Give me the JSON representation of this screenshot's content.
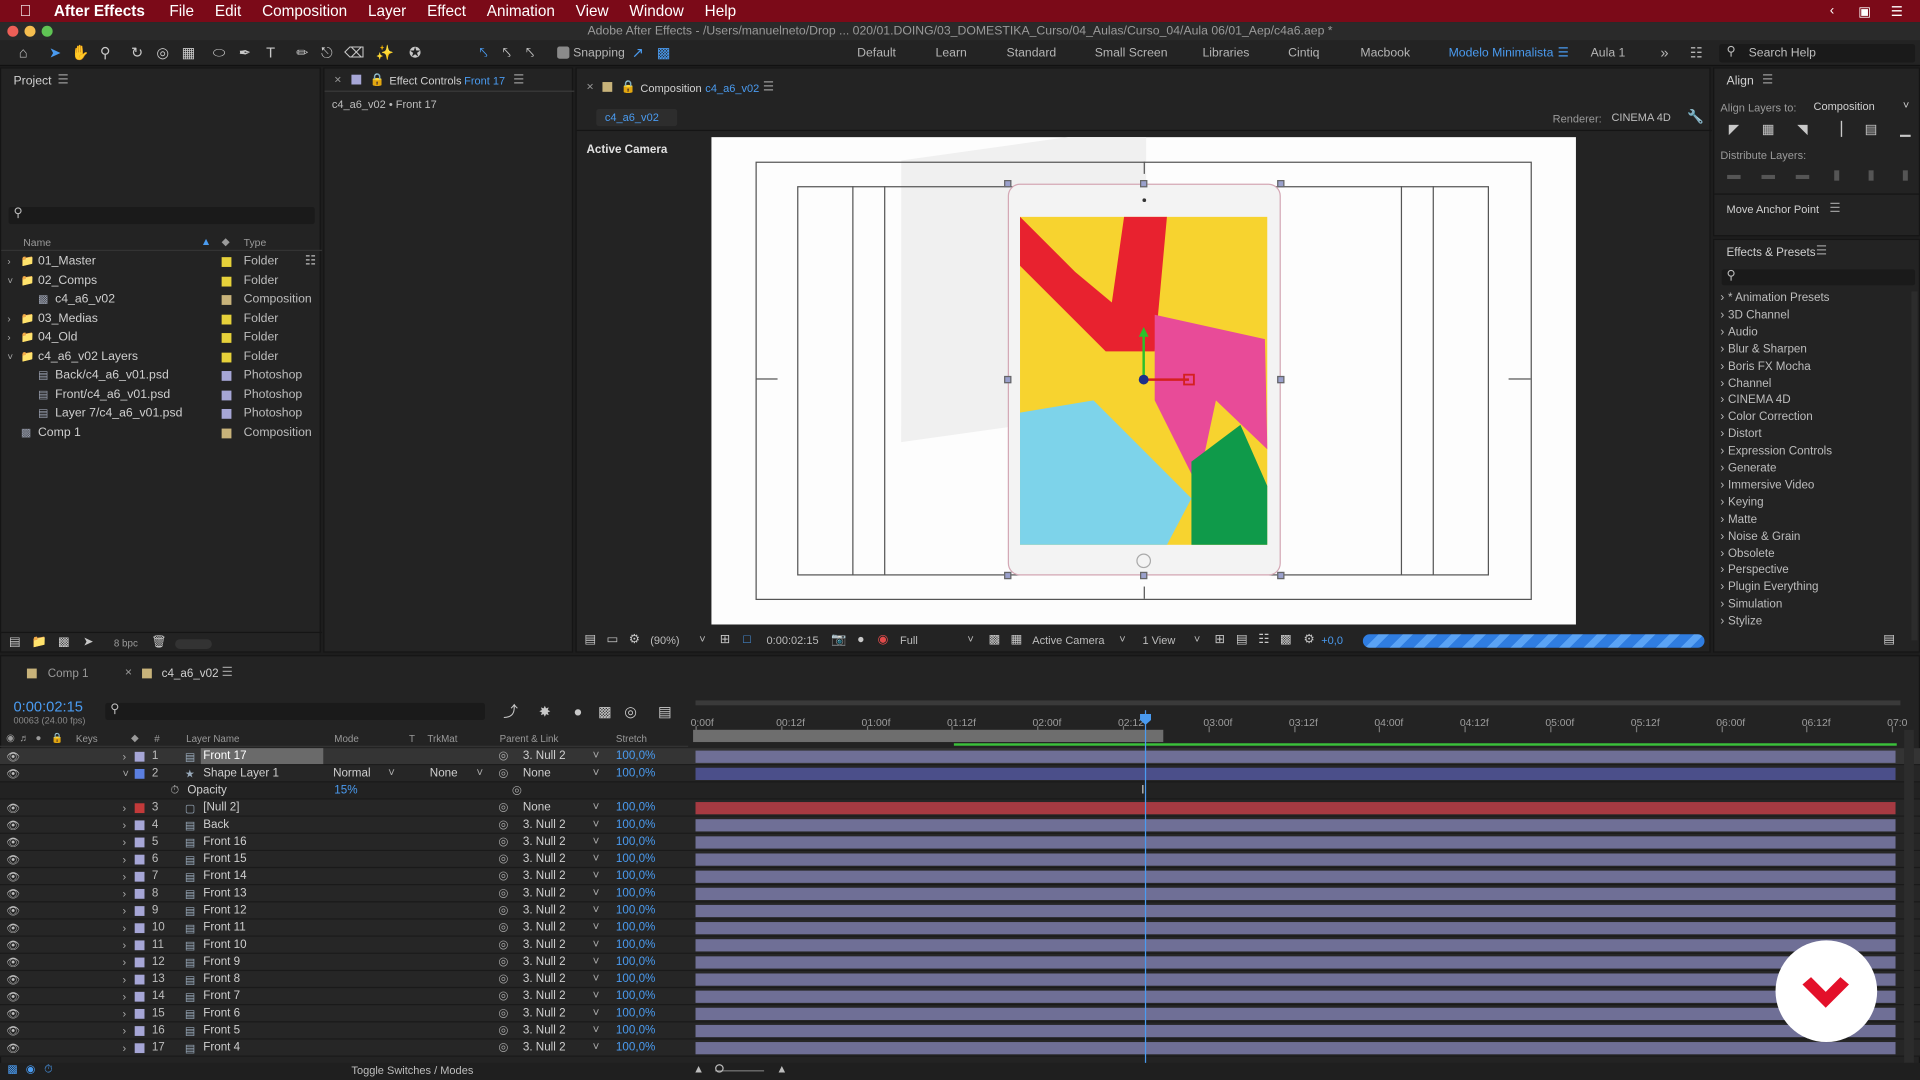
{
  "menu": {
    "app": "After Effects",
    "items": [
      "File",
      "Edit",
      "Composition",
      "Layer",
      "Effect",
      "Animation",
      "View",
      "Window",
      "Help"
    ]
  },
  "window_title": "Adobe After Effects - /Users/manuelneto/Drop ... 020/01.DOING/03_DOMESTIKA_Curso/04_Aulas/Curso_04/Aula 06/01_Aep/c4a6.aep *",
  "toolbar": {
    "snapping": "Snapping",
    "workspaces": [
      "Default",
      "Learn",
      "Standard",
      "Small Screen",
      "Libraries",
      "Cintiq",
      "Macbook",
      "Modelo Minimalista",
      "Aula 1"
    ],
    "active_workspace": "Modelo Minimalista",
    "search_help": "Search Help"
  },
  "project": {
    "title": "Project",
    "search_placeholder": "",
    "col_name": "Name",
    "col_type": "Type",
    "bpc": "8 bpc",
    "items": [
      {
        "name": "01_Master",
        "type": "Folder",
        "color": "#e6d13a"
      },
      {
        "name": "02_Comps",
        "type": "Folder",
        "color": "#e6d13a"
      },
      {
        "name": "c4_a6_v02",
        "type": "Composition",
        "color": "#c8b37a"
      },
      {
        "name": "03_Medias",
        "type": "Folder",
        "color": "#e6d13a"
      },
      {
        "name": "04_Old",
        "type": "Folder",
        "color": "#e6d13a"
      },
      {
        "name": "c4_a6_v02 Layers",
        "type": "Folder",
        "color": "#e6d13a"
      },
      {
        "name": "Back/c4_a6_v01.psd",
        "type": "Photoshop",
        "color": "#a6a6d6"
      },
      {
        "name": "Front/c4_a6_v01.psd",
        "type": "Photoshop",
        "color": "#a6a6d6"
      },
      {
        "name": "Layer 7/c4_a6_v01.psd",
        "type": "Photoshop",
        "color": "#a6a6d6"
      },
      {
        "name": "Comp 1",
        "type": "Composition",
        "color": "#c8b37a"
      }
    ]
  },
  "effect_controls": {
    "title": "Effect Controls",
    "layer": "Front 17",
    "subtitle": "c4_a6_v02 • Front 17"
  },
  "composition": {
    "title": "Composition",
    "name": "c4_a6_v02",
    "tab": "c4_a6_v02",
    "renderer_label": "Renderer:",
    "renderer": "CINEMA 4D",
    "view_label": "Active Camera",
    "footer": {
      "zoom": "(90%)",
      "timecode": "0:00:02:15",
      "resolution": "Full",
      "camera": "Active Camera",
      "views": "1 View",
      "exposure": "+0,0"
    }
  },
  "align": {
    "title": "Align",
    "align_to_label": "Align Layers to:",
    "align_to": "Composition",
    "distribute_label": "Distribute Layers:"
  },
  "move_anchor": {
    "title": "Move Anchor Point"
  },
  "effects": {
    "title": "Effects & Presets",
    "search_placeholder": "",
    "items": [
      "* Animation Presets",
      "3D Channel",
      "Audio",
      "Blur & Sharpen",
      "Boris FX Mocha",
      "Channel",
      "CINEMA 4D",
      "Color Correction",
      "Distort",
      "Expression Controls",
      "Generate",
      "Immersive Video",
      "Keying",
      "Matte",
      "Noise & Grain",
      "Obsolete",
      "Perspective",
      "Plugin Everything",
      "Simulation",
      "Stylize"
    ]
  },
  "timeline": {
    "tabs": [
      "Comp 1",
      "c4_a6_v02"
    ],
    "timecode": "0:00:02:15",
    "fps": "00063 (24.00 fps)",
    "headers": {
      "keys": "Keys",
      "num": "#",
      "layer": "Layer Name",
      "mode": "Mode",
      "t": "T",
      "trkmat": "TrkMat",
      "parent": "Parent & Link",
      "stretch": "Stretch"
    },
    "ticks": [
      "0:00f",
      "00:12f",
      "01:00f",
      "01:12f",
      "02:00f",
      "02:12f",
      "03:00f",
      "03:12f",
      "04:00f",
      "04:12f",
      "05:00f",
      "05:12f",
      "06:00f",
      "06:12f",
      "07:0"
    ],
    "opacity_label": "Opacity",
    "opacity_value": "15%",
    "toggle": "Toggle Switches / Modes",
    "layers": [
      {
        "num": "1",
        "name": "Front 17",
        "mode": "",
        "trkmat": "",
        "parent": "3. Null 2",
        "stretch": "100,0%",
        "color": "#a6a6d6"
      },
      {
        "num": "2",
        "name": "Shape Layer 1",
        "mode": "Normal",
        "trkmat": "None",
        "parent": "None",
        "stretch": "100,0%",
        "color": "#5b7fe0"
      },
      {
        "num": "3",
        "name": "[Null 2]",
        "mode": "",
        "trkmat": "",
        "parent": "None",
        "stretch": "100,0%",
        "color": "#c23a3a"
      },
      {
        "num": "4",
        "name": "Back",
        "mode": "",
        "trkmat": "",
        "parent": "3. Null 2",
        "stretch": "100,0%",
        "color": "#a6a6d6"
      },
      {
        "num": "5",
        "name": "Front 16",
        "mode": "",
        "trkmat": "",
        "parent": "3. Null 2",
        "stretch": "100,0%",
        "color": "#a6a6d6"
      },
      {
        "num": "6",
        "name": "Front 15",
        "mode": "",
        "trkmat": "",
        "parent": "3. Null 2",
        "stretch": "100,0%",
        "color": "#a6a6d6"
      },
      {
        "num": "7",
        "name": "Front 14",
        "mode": "",
        "trkmat": "",
        "parent": "3. Null 2",
        "stretch": "100,0%",
        "color": "#a6a6d6"
      },
      {
        "num": "8",
        "name": "Front 13",
        "mode": "",
        "trkmat": "",
        "parent": "3. Null 2",
        "stretch": "100,0%",
        "color": "#a6a6d6"
      },
      {
        "num": "9",
        "name": "Front 12",
        "mode": "",
        "trkmat": "",
        "parent": "3. Null 2",
        "stretch": "100,0%",
        "color": "#a6a6d6"
      },
      {
        "num": "10",
        "name": "Front 11",
        "mode": "",
        "trkmat": "",
        "parent": "3. Null 2",
        "stretch": "100,0%",
        "color": "#a6a6d6"
      },
      {
        "num": "11",
        "name": "Front 10",
        "mode": "",
        "trkmat": "",
        "parent": "3. Null 2",
        "stretch": "100,0%",
        "color": "#a6a6d6"
      },
      {
        "num": "12",
        "name": "Front 9",
        "mode": "",
        "trkmat": "",
        "parent": "3. Null 2",
        "stretch": "100,0%",
        "color": "#a6a6d6"
      },
      {
        "num": "13",
        "name": "Front 8",
        "mode": "",
        "trkmat": "",
        "parent": "3. Null 2",
        "stretch": "100,0%",
        "color": "#a6a6d6"
      },
      {
        "num": "14",
        "name": "Front 7",
        "mode": "",
        "trkmat": "",
        "parent": "3. Null 2",
        "stretch": "100,0%",
        "color": "#a6a6d6"
      },
      {
        "num": "15",
        "name": "Front 6",
        "mode": "",
        "trkmat": "",
        "parent": "3. Null 2",
        "stretch": "100,0%",
        "color": "#a6a6d6"
      },
      {
        "num": "16",
        "name": "Front 5",
        "mode": "",
        "trkmat": "",
        "parent": "3. Null 2",
        "stretch": "100,0%",
        "color": "#a6a6d6"
      },
      {
        "num": "17",
        "name": "Front 4",
        "mode": "",
        "trkmat": "",
        "parent": "3. Null 2",
        "stretch": "100,0%",
        "color": "#a6a6d6"
      }
    ]
  }
}
